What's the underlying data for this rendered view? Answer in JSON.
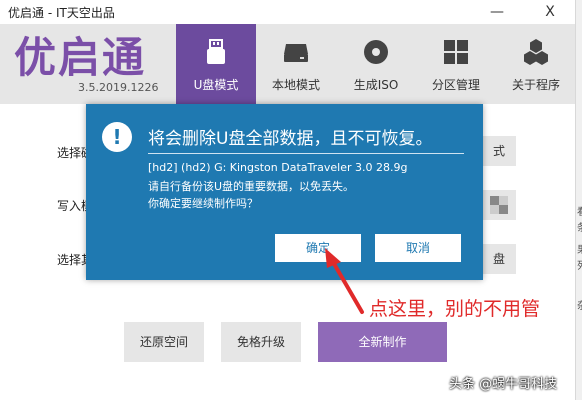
{
  "window": {
    "title": "优启通 - IT天空出品",
    "minimize": "—",
    "close": "X"
  },
  "header": {
    "logo": "优启通",
    "version": "3.5.2019.1226",
    "tabs": [
      {
        "label": "U盘模式",
        "icon": "usb-drive-icon",
        "active": true
      },
      {
        "label": "本地模式",
        "icon": "hard-disk-icon",
        "active": false
      },
      {
        "label": "生成ISO",
        "icon": "disc-icon",
        "active": false
      },
      {
        "label": "分区管理",
        "icon": "partition-grid-icon",
        "active": false
      },
      {
        "label": "关于程序",
        "icon": "hexagons-icon",
        "active": false
      }
    ]
  },
  "main": {
    "row_labels": [
      "选择磁",
      "写入模",
      "选择其"
    ],
    "side_buttons": [
      "式",
      "",
      "盘"
    ],
    "bottom": {
      "restore": "还原空间",
      "upgrade": "免格升级",
      "create": "全新制作"
    }
  },
  "dialog": {
    "icon": "exclamation-icon",
    "title": "将会删除U盘全部数据，且不可恢复。",
    "lines": [
      "[hd2] (hd2) G: Kingston DataTraveler 3.0 28.9g",
      "请自行备份该U盘的重要数据，以免丢失。",
      "你确定要继续制作吗？"
    ],
    "ok": "确定",
    "cancel": "取消"
  },
  "annotation": {
    "text": "点这里，别的不用管",
    "color": "#e02a2a"
  },
  "watermark": "头条 @蜗牛哥科技",
  "right_edge_text": [
    "看",
    "条",
    "果",
    "列",
    "杂"
  ],
  "colors": {
    "accent": "#6c4b9e",
    "dialog": "#1f79b1",
    "header": "#e6e6e6"
  }
}
